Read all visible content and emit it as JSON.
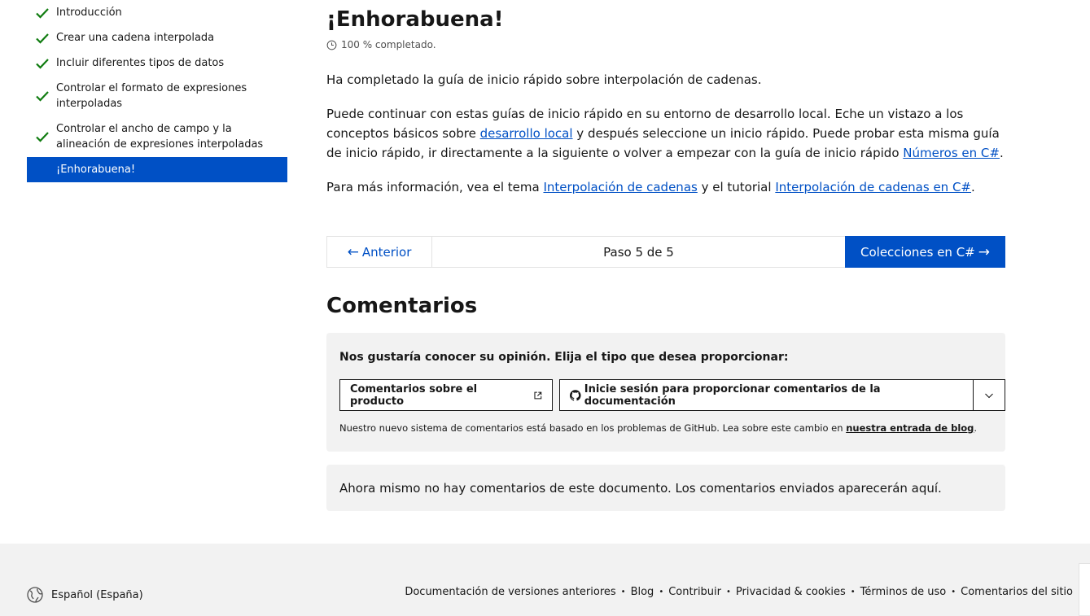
{
  "sidebar": {
    "items": [
      {
        "label": "Introducción"
      },
      {
        "label": "Crear una cadena interpolada"
      },
      {
        "label": "Incluir diferentes tipos de datos"
      },
      {
        "label": "Controlar el formato de expresiones interpoladas"
      },
      {
        "label": "Controlar el ancho de campo y la alineación de expresiones interpoladas"
      },
      {
        "label": "¡Enhorabuena!"
      }
    ]
  },
  "main": {
    "title": "¡Enhorabuena!",
    "progress": "100 % completado.",
    "p1": "Ha completado la guía de inicio rápido sobre interpolación de cadenas.",
    "p2": {
      "t1": "Puede continuar con estas guías de inicio rápido en su entorno de desarrollo local. Eche un vistazo a los conceptos básicos sobre ",
      "link1": "desarrollo local",
      "t2": " y después seleccione un inicio rápido. Puede probar esta misma guía de inicio rápido, ir directamente a la siguiente o volver a empezar con la guía de inicio rápido ",
      "link2": "Números en C#",
      "t3": "."
    },
    "p3": {
      "t1": "Para más información, vea el tema ",
      "link1": "Interpolación de cadenas",
      "t2": " y el tutorial ",
      "link2": "Interpolación de cadenas en C#",
      "t3": "."
    }
  },
  "stepnav": {
    "prev_label": "Anterior",
    "step_text": "Paso 5 de 5",
    "next_label": "Colecciones en C#"
  },
  "feedback": {
    "section_title": "Comentarios",
    "heading": "Nos gustaría conocer su opinión. Elija el tipo que desea proporcionar:",
    "product_button": "Comentarios sobre el producto",
    "docs_button": "Inicie sesión para proporcionar comentarios de la documentación",
    "note_text": "Nuestro nuevo sistema de comentarios está basado en los problemas de GitHub. Lea sobre este cambio en ",
    "note_link": "nuestra entrada de blog",
    "note_end": ".",
    "no_comments": "Ahora mismo no hay comentarios de este documento. Los comentarios enviados aparecerán aquí."
  },
  "footer": {
    "locale": "Español (España)",
    "links": [
      "Documentación de versiones anteriores",
      "Blog",
      "Contribuir",
      "Privacidad & cookies",
      "Términos de uso",
      "Comentarios del sitio"
    ]
  },
  "colors": {
    "accent": "#0050c5",
    "check": "#107c10",
    "panel": "#f2f2f2"
  }
}
